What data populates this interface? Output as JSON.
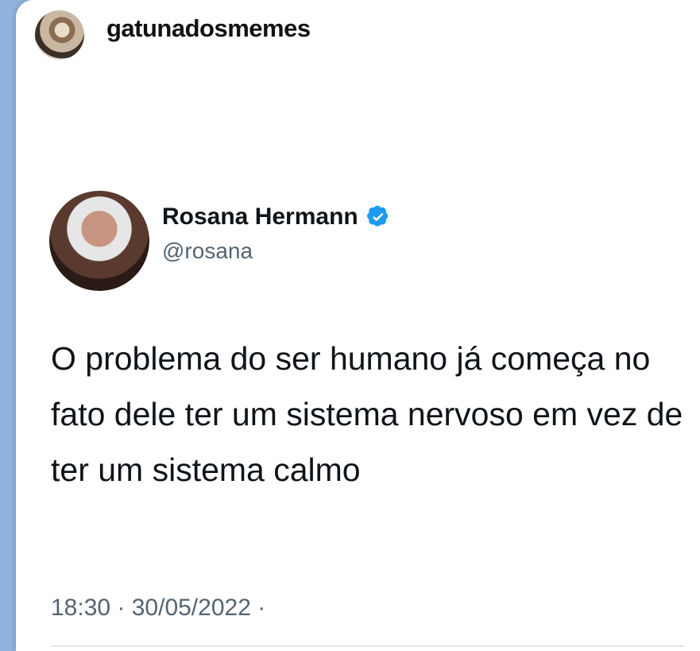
{
  "post": {
    "username": "gatunadosmemes"
  },
  "tweet": {
    "display_name": "Rosana Hermann",
    "handle": "@rosana",
    "text": "O problema do ser humano já começa no fato dele ter um sistema nervoso em vez de ter um sistema calmo",
    "timestamp": "18:30 · 30/05/2022 ·"
  },
  "icons": {
    "verified": "verified-badge-icon",
    "verified_color": "#1d9bf0"
  }
}
